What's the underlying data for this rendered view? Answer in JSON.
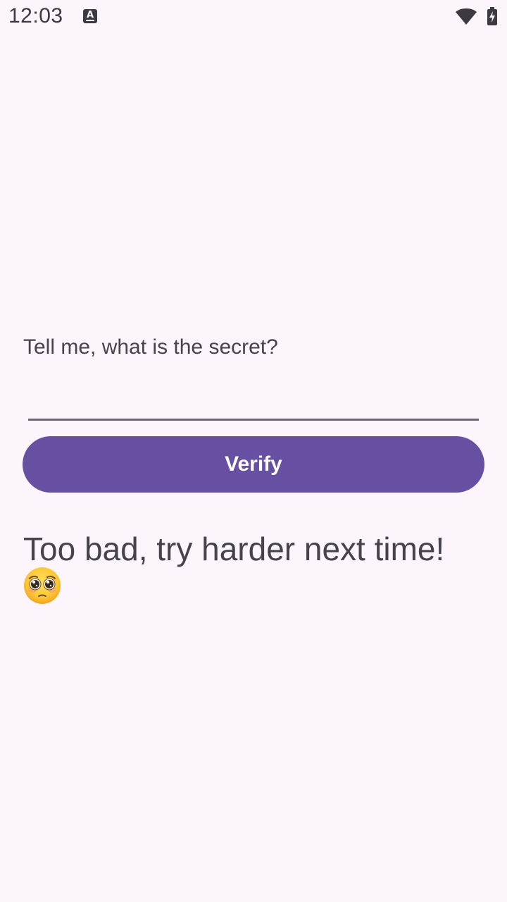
{
  "status_bar": {
    "time": "12:03",
    "notification_icon": "keyboard-a-icon",
    "wifi_icon": "wifi-icon",
    "battery_icon": "battery-charging-icon"
  },
  "main": {
    "prompt": "Tell me, what is the secret?",
    "input": {
      "value": "",
      "placeholder": ""
    },
    "verify_label": "Verify",
    "result_message": "Too bad, try harder next time!",
    "result_emoji_icon": "pleading-face-icon"
  },
  "colors": {
    "background": "#fcf6fc",
    "accent": "#674fa2",
    "text": "#46434c",
    "underline": "#6b6575"
  }
}
